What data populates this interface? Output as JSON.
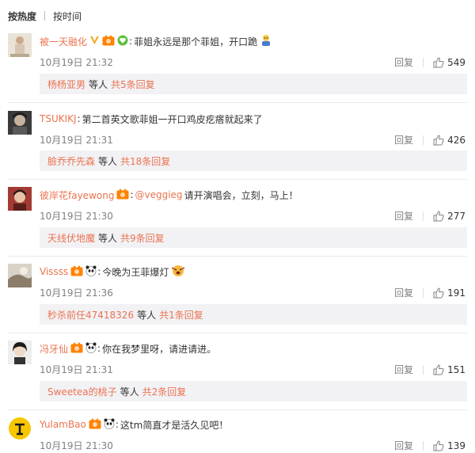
{
  "sort": {
    "hot": "按热度",
    "time": "按时间"
  },
  "labels": {
    "reply": "回复",
    "others": "等人"
  },
  "comments": [
    {
      "user": "被一天融化",
      "badges": [
        "verified-v-icon",
        "fan-badge-icon",
        "vip-heart-icon"
      ],
      "mention": "",
      "text": "菲姐永远是那个菲姐，开口跪",
      "emoji": "kneel-emoji-icon",
      "time": "10月19日 21:32",
      "likes": "549",
      "reply_user": "杨杨亚男",
      "reply_total": "共5条回复"
    },
    {
      "user": "TSUKIKJ",
      "badges": [],
      "mention": "",
      "text": "第二首英文歌菲姐一开口鸡皮疙瘩就起来了",
      "emoji": "",
      "time": "10月19日 21:31",
      "likes": "426",
      "reply_user": "臉乔乔先森",
      "reply_total": "共18条回复"
    },
    {
      "user": "彼岸花fayewong",
      "badges": [
        "fan-badge-icon"
      ],
      "mention": "@veggieg",
      "text": "请开演唱会，立刻，马上！",
      "emoji": "",
      "time": "10月19日 21:30",
      "likes": "277",
      "reply_user": "天线伏地魔",
      "reply_total": "共9条回复"
    },
    {
      "user": "Vissss",
      "badges": [
        "fan-badge-icon",
        "panda-icon"
      ],
      "mention": "",
      "text": "今晚为王菲爆灯",
      "emoji": "shock-emoji-icon",
      "time": "10月19日 21:36",
      "likes": "191",
      "reply_user": "秒杀前任47418326",
      "reply_total": "共1条回复"
    },
    {
      "user": "冯牙仙",
      "badges": [
        "fan-badge-icon",
        "panda-icon"
      ],
      "mention": "",
      "text": "你在我梦里呀，请进请进。",
      "emoji": "",
      "time": "10月19日 21:31",
      "likes": "151",
      "reply_user": "Sweetea的桃子",
      "reply_total": "共2条回复"
    },
    {
      "user": "YulamBao",
      "badges": [
        "fan-badge-icon",
        "panda-icon"
      ],
      "mention": "",
      "text": "这tm简直才是活久见吧！",
      "emoji": "",
      "time": "10月19日 21:30",
      "likes": "139",
      "reply_user": "",
      "reply_total": ""
    }
  ]
}
